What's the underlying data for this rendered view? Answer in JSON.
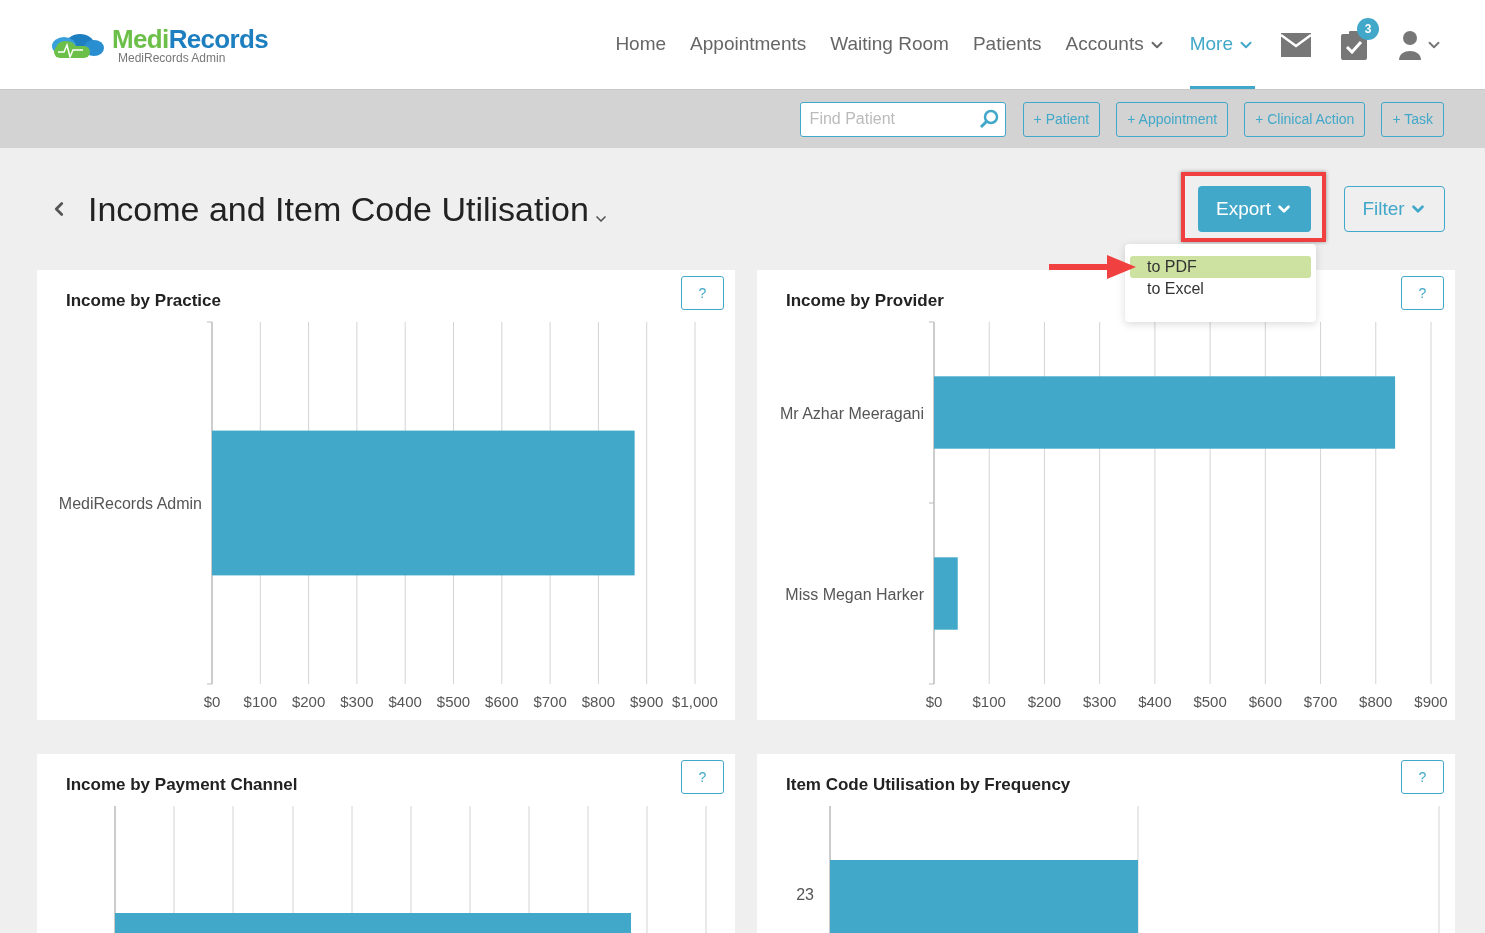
{
  "header": {
    "logo": {
      "brand_first": "Medi",
      "brand_second": "Records",
      "subtitle": "MediRecords Admin"
    },
    "nav": [
      {
        "label": "Home",
        "selected": false,
        "dropdown": false
      },
      {
        "label": "Appointments",
        "selected": false,
        "dropdown": false
      },
      {
        "label": "Waiting Room",
        "selected": false,
        "dropdown": false
      },
      {
        "label": "Patients",
        "selected": false,
        "dropdown": false
      },
      {
        "label": "Accounts",
        "selected": false,
        "dropdown": true
      },
      {
        "label": "More",
        "selected": true,
        "dropdown": true
      }
    ],
    "tasks_badge": "3"
  },
  "toolbar": {
    "search": {
      "placeholder": "Find Patient"
    },
    "buttons": [
      "+ Patient",
      "+ Appointment",
      "+ Clinical Action",
      "+ Task"
    ]
  },
  "page": {
    "title": "Income and Item Code Utilisation",
    "export_button": "Export",
    "filter_button": "Filter",
    "export_menu": [
      {
        "label": "to PDF",
        "selected": true
      },
      {
        "label": "to Excel",
        "selected": false
      }
    ]
  },
  "cards": [
    {
      "title": "Income by Practice",
      "help": "?",
      "chart_data": {
        "type": "bar",
        "orientation": "horizontal",
        "grid": true,
        "categories": [
          "MediRecords Admin"
        ],
        "values": [
          875
        ],
        "xlim": [
          0,
          1000
        ],
        "xticks": [
          {
            "value": 0,
            "label": "$0"
          },
          {
            "value": 100,
            "label": "$100"
          },
          {
            "value": 200,
            "label": "$200"
          },
          {
            "value": 300,
            "label": "$300"
          },
          {
            "value": 400,
            "label": "$400"
          },
          {
            "value": 500,
            "label": "$500"
          },
          {
            "value": 600,
            "label": "$600"
          },
          {
            "value": 700,
            "label": "$700"
          },
          {
            "value": 800,
            "label": "$800"
          },
          {
            "value": 900,
            "label": "$900"
          },
          {
            "value": 1000,
            "label": "$1,000"
          }
        ]
      }
    },
    {
      "title": "Income by Provider",
      "help": "?",
      "chart_data": {
        "type": "bar",
        "orientation": "horizontal",
        "grid": true,
        "categories": [
          "Mr Azhar Meeragani",
          "Miss Megan Harker"
        ],
        "values": [
          835,
          43
        ],
        "xlim": [
          0,
          900
        ],
        "xticks": [
          {
            "value": 0,
            "label": "$0"
          },
          {
            "value": 100,
            "label": "$100"
          },
          {
            "value": 200,
            "label": "$200"
          },
          {
            "value": 300,
            "label": "$300"
          },
          {
            "value": 400,
            "label": "$400"
          },
          {
            "value": 500,
            "label": "$500"
          },
          {
            "value": 600,
            "label": "$600"
          },
          {
            "value": 700,
            "label": "$700"
          },
          {
            "value": 800,
            "label": "$800"
          },
          {
            "value": 900,
            "label": "$900"
          }
        ]
      }
    },
    {
      "title": "Income by Payment Channel",
      "help": "?"
    },
    {
      "title": "Item Code Utilisation by Frequency",
      "help": "?",
      "category_labels": [
        "23"
      ]
    }
  ]
}
